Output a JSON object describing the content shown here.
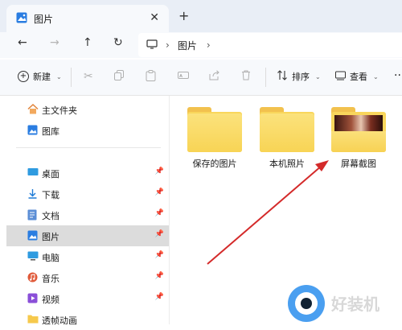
{
  "window": {
    "tab_title": "图片",
    "tab_close_glyph": "✕",
    "tab_add_glyph": "+"
  },
  "nav": {
    "back_glyph": "←",
    "forward_glyph": "→",
    "up_glyph": "↑",
    "refresh_glyph": "↻"
  },
  "address": {
    "separator": "›",
    "segment": "图片",
    "trailing_separator": "›"
  },
  "toolbar": {
    "new_label": "新建",
    "sort_label": "排序",
    "view_label": "查看",
    "more_glyph": "··"
  },
  "sidebar": {
    "items": [
      {
        "label": "主文件夹",
        "icon": "home-icon",
        "pinned": false
      },
      {
        "label": "图库",
        "icon": "gallery-icon",
        "pinned": false
      },
      {
        "label": "桌面",
        "icon": "desktop-icon",
        "pinned": true
      },
      {
        "label": "下载",
        "icon": "download-icon",
        "pinned": true
      },
      {
        "label": "文档",
        "icon": "document-icon",
        "pinned": true
      },
      {
        "label": "图片",
        "icon": "pictures-icon",
        "pinned": true,
        "selected": true
      },
      {
        "label": "电脑",
        "icon": "computer-icon",
        "pinned": true
      },
      {
        "label": "音乐",
        "icon": "music-icon",
        "pinned": true
      },
      {
        "label": "视频",
        "icon": "video-icon",
        "pinned": true
      },
      {
        "label": "透帧动画",
        "icon": "folder-icon",
        "pinned": false
      }
    ]
  },
  "content": {
    "folders": [
      {
        "label": "保存的图片",
        "has_preview": false
      },
      {
        "label": "本机照片",
        "has_preview": false
      },
      {
        "label": "屏幕截图",
        "has_preview": true
      }
    ]
  },
  "watermark": {
    "text": "好装机"
  },
  "colors": {
    "accent_blue": "#1a73e8",
    "folder_yellow": "#f9d65c",
    "arrow_red": "#d42a2a",
    "selected_bg": "#dcdcdc"
  }
}
